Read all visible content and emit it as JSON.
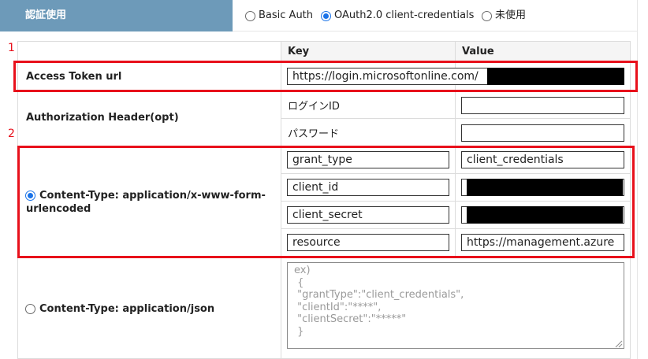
{
  "auth": {
    "title": "認証使用",
    "options": [
      {
        "label": "Basic Auth",
        "selected": false
      },
      {
        "label": "OAuth2.0 client-credentials",
        "selected": true
      },
      {
        "label": "未使用",
        "selected": false
      }
    ]
  },
  "table": {
    "headers": {
      "key": "Key",
      "value": "Value"
    }
  },
  "access_token": {
    "label": "Access Token url",
    "value": "https://login.microsoftonline.com/"
  },
  "auth_header": {
    "label": "Authorization Header(opt)",
    "login_id_label": "ログインID",
    "login_id_value": "",
    "password_label": "パスワード",
    "password_value": ""
  },
  "form_urlencoded": {
    "label_line1": "Content-Type: application/x-www-form-",
    "label_line2": "urlencoded",
    "selected": true,
    "params": [
      {
        "key": "grant_type",
        "value": "client_credentials",
        "redacted": false
      },
      {
        "key": "client_id",
        "value": "",
        "redacted": true
      },
      {
        "key": "client_secret",
        "value": "",
        "redacted": true
      },
      {
        "key": "resource",
        "value": "https://management.azure",
        "redacted": false
      }
    ]
  },
  "json_body": {
    "label": "Content-Type: application/json",
    "selected": false,
    "placeholder": "ex)\n {\n \"grantType\":\"client_credentials\",\n \"clientId\":\"****\",\n \"clientSecret\":\"*****\"\n }"
  },
  "annotations": {
    "step1": "1",
    "step2": "2"
  },
  "colors": {
    "header_bg": "#6d9ab9",
    "highlight_red": "#e8101b",
    "radio_blue": "#1a73e8"
  }
}
